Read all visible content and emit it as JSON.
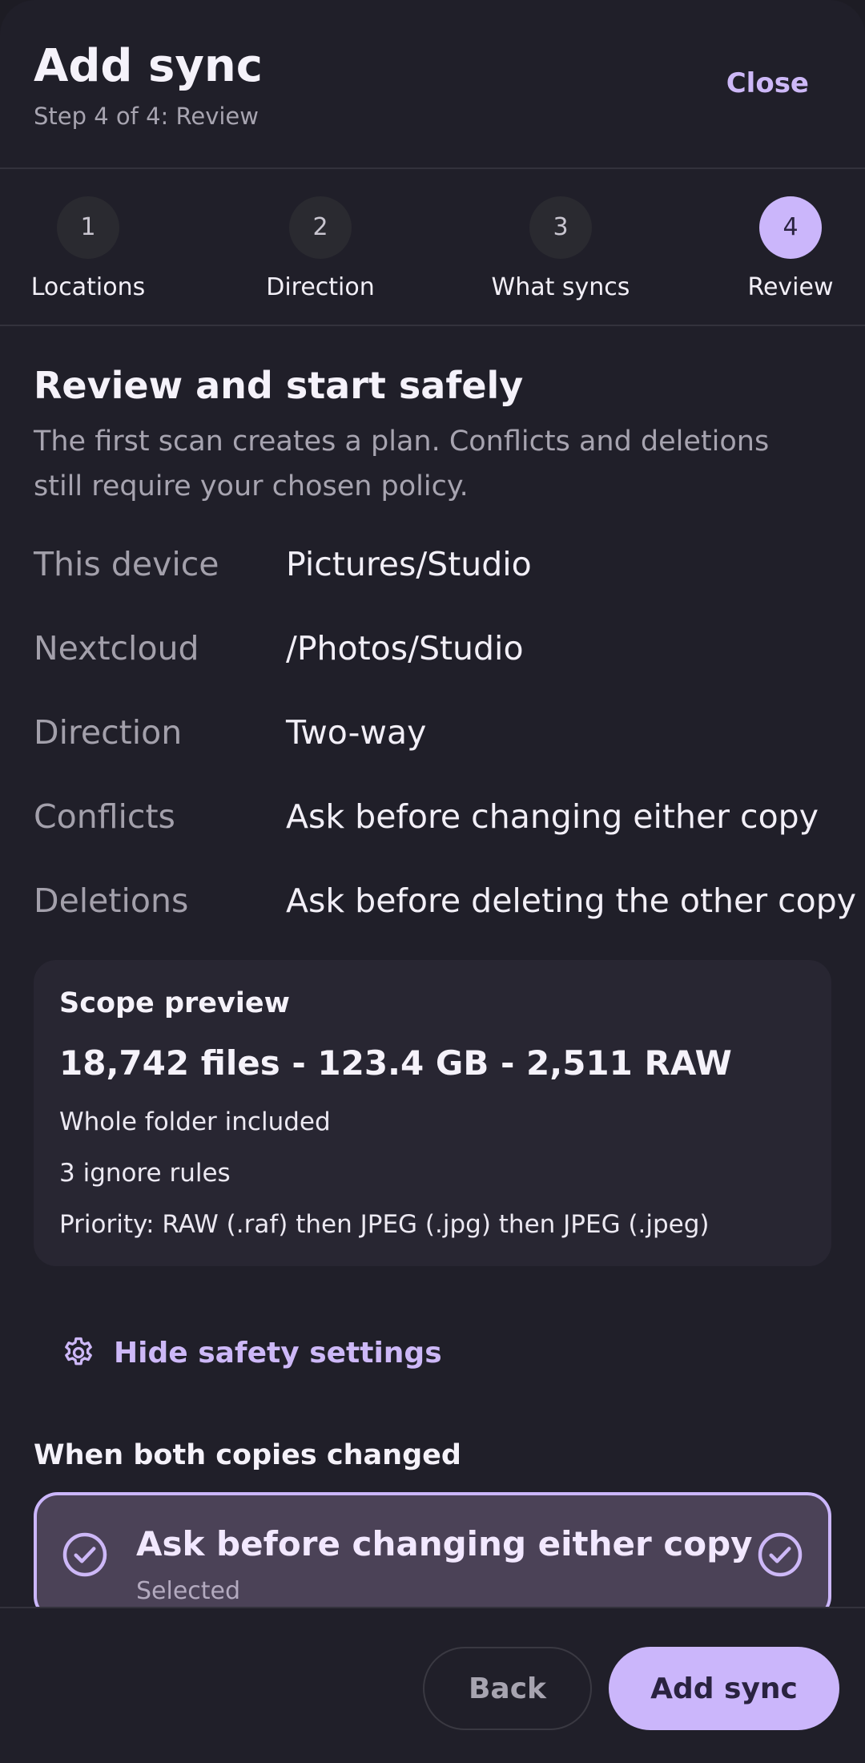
{
  "header": {
    "title": "Add sync",
    "subtitle": "Step 4 of 4: Review",
    "close_label": "Close"
  },
  "stepper": {
    "steps": [
      {
        "number": "1",
        "label": "Locations"
      },
      {
        "number": "2",
        "label": "Direction"
      },
      {
        "number": "3",
        "label": "What syncs"
      },
      {
        "number": "4",
        "label": "Review"
      }
    ],
    "active_step": "4"
  },
  "review": {
    "title": "Review and start safely",
    "description": "The first scan creates a plan. Conflicts and deletions still require your chosen policy.",
    "summary": [
      {
        "key": "This device",
        "value": "Pictures/Studio"
      },
      {
        "key": "Nextcloud",
        "value": "/Photos/Studio"
      },
      {
        "key": "Direction",
        "value": "Two-way"
      },
      {
        "key": "Conflicts",
        "value": "Ask before changing either copy"
      },
      {
        "key": "Deletions",
        "value": "Ask before deleting the other copy"
      }
    ]
  },
  "scope": {
    "title": "Scope preview",
    "stats": "18,742 files - 123.4 GB - 2,511 RAW",
    "lines": [
      "Whole folder included",
      "3 ignore rules",
      "Priority: RAW (.raf) then JPEG (.jpg) then JPEG (.jpeg)"
    ]
  },
  "safety": {
    "toggle_label": "Hide safety settings",
    "icon": "gear-icon",
    "conflict_heading": "When both copies changed",
    "selected_option": {
      "title": "Ask before changing either copy",
      "status": "Selected"
    }
  },
  "footer": {
    "back_label": "Back",
    "add_label": "Add sync"
  },
  "colors": {
    "accent": "#cbb6fb",
    "background": "#201f29",
    "surface": "#282632",
    "selected_surface": "#4b4257"
  }
}
